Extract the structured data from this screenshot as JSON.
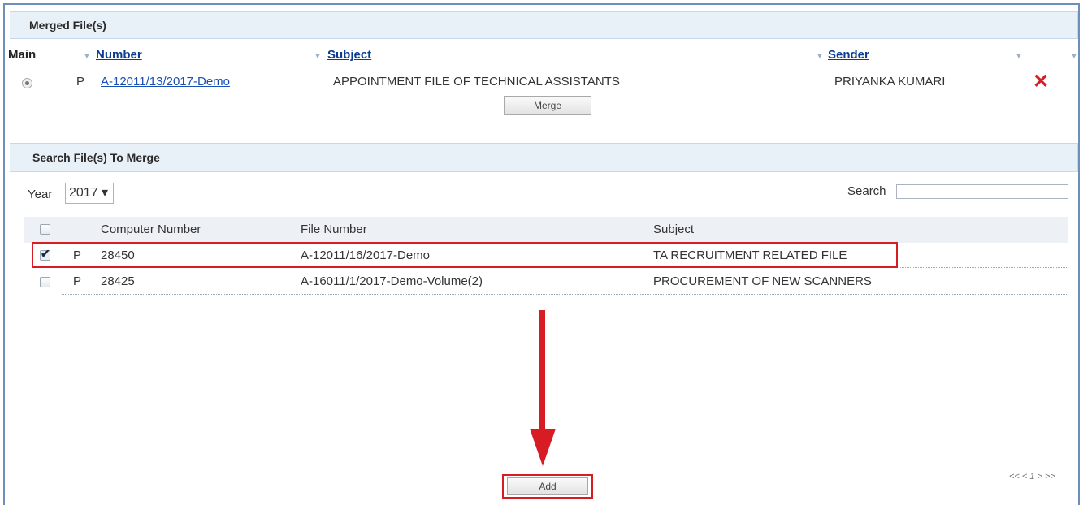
{
  "merged_section": {
    "title": "Merged File(s)",
    "columns": {
      "main": "Main",
      "number": "Number",
      "subject": "Subject",
      "sender": "Sender"
    },
    "row": {
      "type": "P",
      "number": "A-12011/13/2017-Demo",
      "subject": "APPOINTMENT FILE OF TECHNICAL ASSISTANTS",
      "sender": "PRIYANKA KUMARI"
    },
    "merge_button": "Merge"
  },
  "search_section": {
    "title": "Search File(s) To Merge",
    "year_label": "Year",
    "year_value": "2017 ▾",
    "search_label": "Search",
    "search_value": "",
    "columns": {
      "computer_number": "Computer Number",
      "file_number": "File Number",
      "subject": "Subject"
    },
    "rows": [
      {
        "checked": true,
        "type": "P",
        "computer_number": "28450",
        "file_number": "A-12011/16/2017-Demo",
        "subject": "TA RECRUITMENT RELATED FILE"
      },
      {
        "checked": false,
        "type": "P",
        "computer_number": "28425",
        "file_number": "A-16011/1/2017-Demo-Volume(2)",
        "subject": "PROCUREMENT OF NEW SCANNERS"
      }
    ],
    "pagination": "<< < 1 > >>",
    "add_button": "Add"
  },
  "colors": {
    "highlight_red": "#d81c24",
    "header_bg": "#e8f0f8",
    "link_blue": "#1a4fb5"
  }
}
